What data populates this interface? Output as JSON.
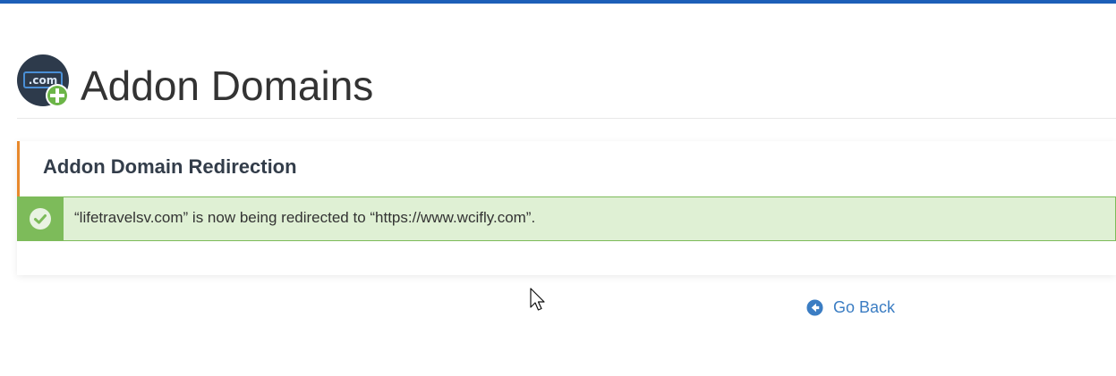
{
  "page": {
    "title": "Addon Domains",
    "icon": "addon-domains-icon",
    "icon_text": ".com",
    "accent_bar_color": "#1d5fb8"
  },
  "panel": {
    "title": "Addon Domain Redirection",
    "heading_accent_color": "#e8892c"
  },
  "alert": {
    "status": "success",
    "icon": "check-circle-icon",
    "message": "“lifetravelsv.com” is now being redirected to “https://www.wcifly.com”.",
    "background_color": "#dff0d4",
    "accent_color": "#7dbb5a"
  },
  "actions": {
    "go_back_label": "Go Back",
    "go_back_icon": "arrow-left-circle-icon",
    "link_color": "#3b7dc3"
  }
}
